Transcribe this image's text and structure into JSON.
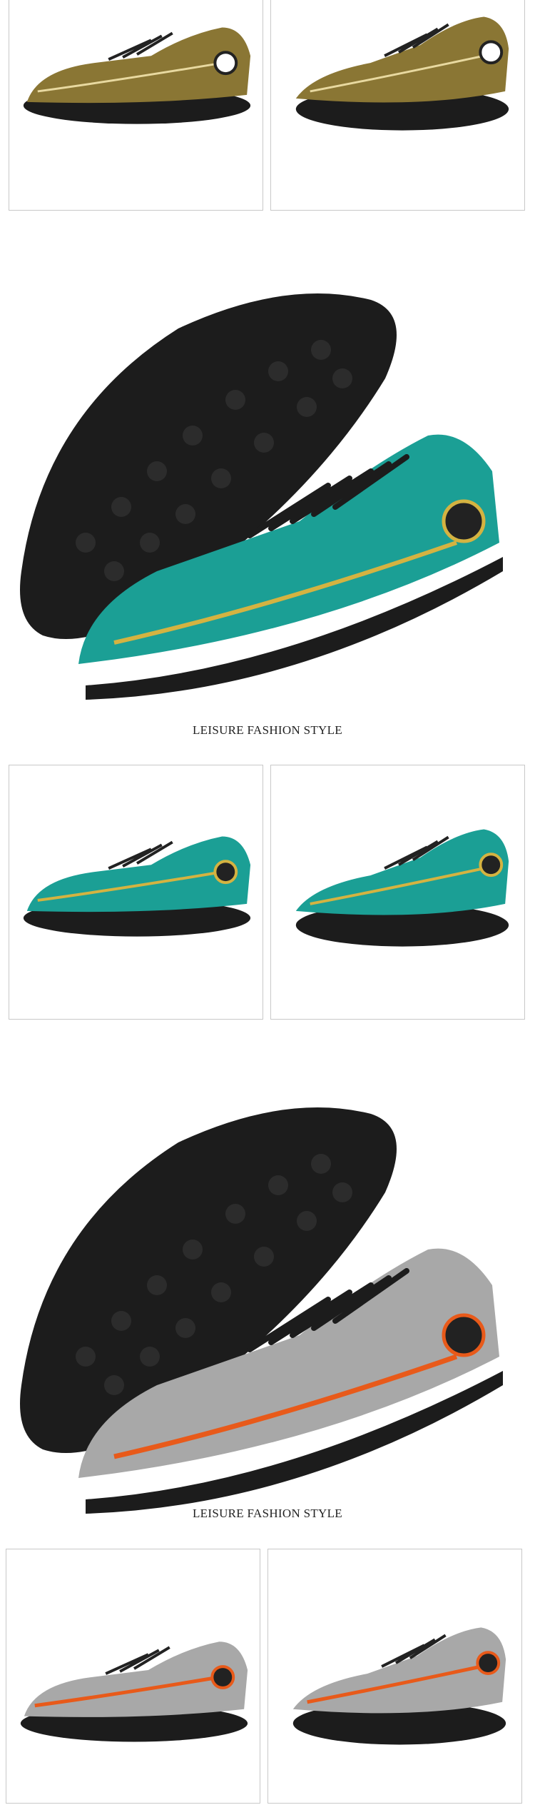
{
  "sections": [
    {
      "colorway": "gold",
      "colors": {
        "upper": "#8a7634",
        "upper_light": "#c8b06a",
        "accent": "#e8d9a0",
        "sole": "#1c1c1c"
      },
      "icons": [
        "shoe-side-view",
        "shoe-angle-view"
      ]
    },
    {
      "colorway": "teal",
      "colors": {
        "upper": "#1b9f95",
        "upper_light": "#39c3b3",
        "accent": "#d4b341",
        "sole": "#1c1c1c"
      },
      "caption": "LEISURE FASHION STYLE",
      "icons": [
        "shoe-hero-view",
        "shoe-side-view",
        "shoe-angle-view"
      ]
    },
    {
      "colorway": "silver",
      "colors": {
        "upper": "#8f8f8f",
        "upper_light": "#d4d4d4",
        "accent": "#e85a1a",
        "sole": "#1c1c1c"
      },
      "caption": "LEISURE FASHION STYLE",
      "icons": [
        "shoe-hero-view",
        "shoe-side-view",
        "shoe-angle-view"
      ]
    }
  ]
}
